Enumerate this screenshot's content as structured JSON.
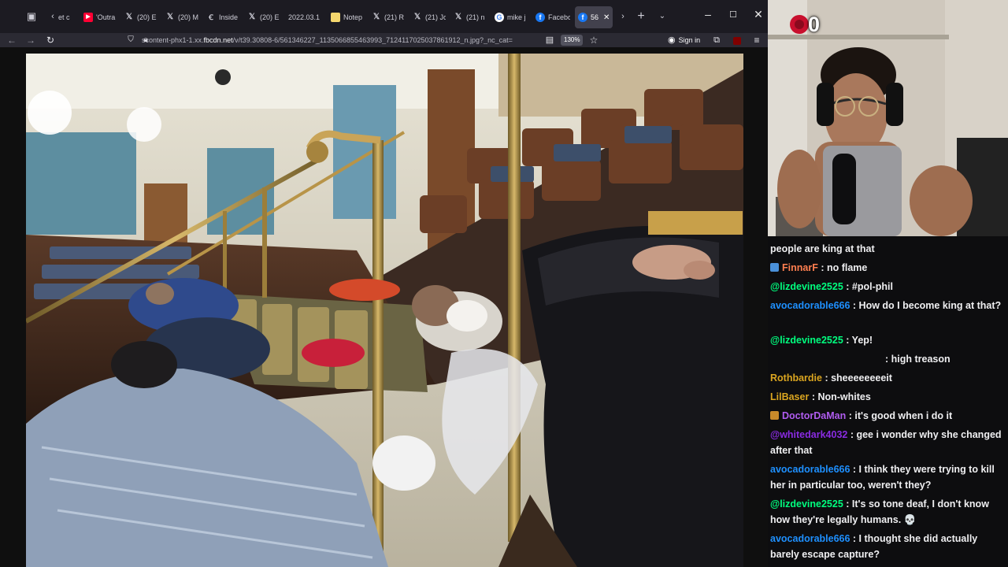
{
  "browser": {
    "tabs": [
      {
        "label": "et c",
        "icon": "generic-icon",
        "color": "#cfcfd8",
        "active": false
      },
      {
        "label": "'Outra",
        "icon": "youtube-icon",
        "color": "#ff0033",
        "active": false
      },
      {
        "label": "(20) E",
        "icon": "x-icon",
        "color": "#ffffff",
        "active": false
      },
      {
        "label": "(20) M",
        "icon": "x-icon",
        "color": "#ffffff",
        "active": false
      },
      {
        "label": "Inside",
        "icon": "generic-icon",
        "color": "#ffffff",
        "active": false
      },
      {
        "label": "(20) E",
        "icon": "x-icon",
        "color": "#ffffff",
        "active": false
      },
      {
        "label": "2022.03.1",
        "icon": "",
        "color": "#ffffff",
        "active": false
      },
      {
        "label": "Notep",
        "icon": "note-icon",
        "color": "#f5d76e",
        "active": false
      },
      {
        "label": "(21) R",
        "icon": "x-icon",
        "color": "#ffffff",
        "active": false
      },
      {
        "label": "(21) Jo",
        "icon": "x-icon",
        "color": "#ffffff",
        "active": false
      },
      {
        "label": "(21) n",
        "icon": "x-icon",
        "color": "#ffffff",
        "active": false
      },
      {
        "label": "mike j",
        "icon": "google-icon",
        "color": "#4285f4",
        "active": false
      },
      {
        "label": "Facebo",
        "icon": "facebook-icon",
        "color": "#1877f2",
        "active": false
      },
      {
        "label": "56",
        "icon": "facebook-icon",
        "color": "#1877f2",
        "active": true
      }
    ],
    "url_prefix": "scontent-phx1-1.xx.",
    "url_domain": "fbcdn.net",
    "url_rest": "/v/t39.30808-6/561346227_1135066855463993_7124117025037861912_n.jpg?_nc_cat=",
    "zoom": "130%",
    "sign_in": "Sign in"
  },
  "stream": {
    "sub_count": "0"
  },
  "chat": {
    "messages": [
      {
        "user": "",
        "text": "people are king at that",
        "color": "#efeff1",
        "badge": ""
      },
      {
        "user": "FinnarF",
        "text": " : no flame",
        "color": "#ff7f50",
        "badge": "#4a90d9"
      },
      {
        "user": "@lizdevine2525",
        "text": " : #pol-phil",
        "color": "#00ff7f",
        "badge": ""
      },
      {
        "user": "avocadorable666",
        "text": " : How do I become king at that?",
        "color": "#1e90ff",
        "badge": ""
      },
      {
        "user": "@lizdevine2525",
        "text": " : Yep!",
        "color": "#00ff7f",
        "badge": ""
      },
      {
        "user": "",
        "text": ": high treason",
        "color": "#efeff1",
        "badge": ""
      },
      {
        "user": "Rothbardie",
        "text": " : sheeeeeeeeit",
        "color": "#daa520",
        "badge": ""
      },
      {
        "user": "LilBaser",
        "text": " : Non-whites",
        "color": "#daa520",
        "badge": ""
      },
      {
        "user": "DoctorDaMan",
        "text": " : it's good when i do it",
        "color": "#b05cf0",
        "badge": "#c98a2a"
      },
      {
        "user": "@whitedark4032",
        "text": " : gee i wonder why she changed after that",
        "color": "#8a2be2",
        "badge": ""
      },
      {
        "user": "avocadorable666",
        "text": " : I think they were trying to kill her in particular too, weren't they?",
        "color": "#1e90ff",
        "badge": ""
      },
      {
        "user": "@lizdevine2525",
        "text": " : It's so tone deaf, I don't know how they're legally humans. 💀",
        "color": "#00ff7f",
        "badge": ""
      },
      {
        "user": "avocadorable666",
        "text": " : I thought she did actually barely escape capture?",
        "color": "#1e90ff",
        "badge": ""
      }
    ]
  }
}
